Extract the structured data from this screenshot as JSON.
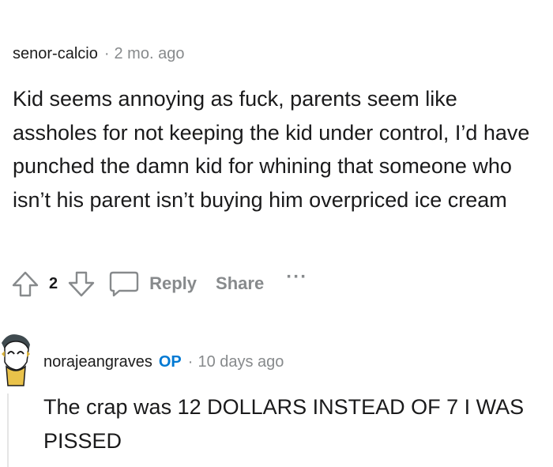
{
  "comment": {
    "author": "senor-calcio",
    "separator": "·",
    "timestamp": "2 mo. ago",
    "body": "Kid seems annoying as fuck, parents seem like assholes for not keeping the kid under control, I’d have punched the damn kid for whining that someone who isn’t his parent isn’t buying him overpriced ice cream",
    "score": "2",
    "reply_label": "Reply",
    "share_label": "Share",
    "more_label": "···"
  },
  "reply": {
    "author": "norajeangraves",
    "op_badge": "OP",
    "separator": "·",
    "timestamp": "10 days ago",
    "body": "The crap was 12 DOLLARS INSTEAD OF 7 I WAS PISSED"
  },
  "colors": {
    "meta_gray": "#878a8c",
    "op_blue": "#0079d3",
    "text": "#1a1a1b"
  },
  "icons": [
    "upvote-icon",
    "downvote-icon",
    "speech-bubble-icon",
    "avatar-icon"
  ]
}
